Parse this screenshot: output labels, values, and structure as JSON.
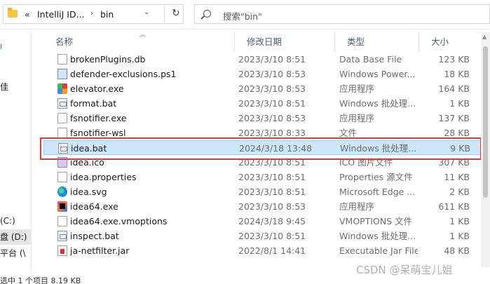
{
  "address": {
    "segments": [
      "«",
      "IntelliJ ID...",
      "›",
      "bin"
    ],
    "dropdown": "⌄",
    "refresh": "↻"
  },
  "search": {
    "placeholder": "搜索\"bin\""
  },
  "nav": {
    "items": [
      {
        "label": "ı"
      },
      {
        "label": "佳"
      },
      {
        "label": "(C:)"
      },
      {
        "label": "盘 (D:)"
      },
      {
        "label": "平台 (\\"
      }
    ]
  },
  "columns": {
    "name": "名称",
    "date": "修改日期",
    "type": "类型",
    "size": "大小"
  },
  "files": [
    {
      "name": "brokenPlugins.db",
      "date": "2023/3/10 8:51",
      "type": "Data Base File",
      "size": "123 KB",
      "icon": "file"
    },
    {
      "name": "defender-exclusions.ps1",
      "date": "2023/3/10 8:53",
      "type": "Windows Power...",
      "size": "18 KB",
      "icon": "powershell"
    },
    {
      "name": "elevator.exe",
      "date": "2023/3/10 8:53",
      "type": "应用程序",
      "size": "164 KB",
      "icon": "exe"
    },
    {
      "name": "format.bat",
      "date": "2023/3/10 8:51",
      "type": "Windows 批处理...",
      "size": "1 KB",
      "icon": "script"
    },
    {
      "name": "fsnotifier.exe",
      "date": "2023/3/10 8:53",
      "type": "应用程序",
      "size": "137 KB",
      "icon": "file"
    },
    {
      "name": "fsnotifier-wsl",
      "date": "2023/3/10 8:33",
      "type": "文件",
      "size": "28 KB",
      "icon": "file"
    },
    {
      "name": "idea.bat",
      "date": "2024/3/18 13:48",
      "type": "Windows 批处理...",
      "size": "9 KB",
      "icon": "script"
    },
    {
      "name": "idea.ico",
      "date": "2023/3/10 8:51",
      "type": "ICO 图片文件",
      "size": "307 KB",
      "icon": "ico"
    },
    {
      "name": "idea.properties",
      "date": "2023/3/10 8:51",
      "type": "Properties 源文件",
      "size": "11 KB",
      "icon": "file"
    },
    {
      "name": "idea.svg",
      "date": "2023/3/10 8:51",
      "type": "Microsoft Edge ...",
      "size": "2 KB",
      "icon": "edge"
    },
    {
      "name": "idea64.exe",
      "date": "2023/3/10 8:53",
      "type": "应用程序",
      "size": "611 KB",
      "icon": "idea"
    },
    {
      "name": "idea64.exe.vmoptions",
      "date": "2024/3/18 9:45",
      "type": "VMOPTIONS 文件",
      "size": "1 KB",
      "icon": "file"
    },
    {
      "name": "inspect.bat",
      "date": "2023/3/10 8:51",
      "type": "Windows 批处理...",
      "size": "1 KB",
      "icon": "script"
    },
    {
      "name": "ja-netfilter.jar",
      "date": "2022/8/1 14:41",
      "type": "Executable Jar File",
      "size": "48 KB",
      "icon": "jar"
    }
  ],
  "selected_index": 6,
  "status": {
    "text": "选中 1 个项目  8.19 KB"
  },
  "watermark": "CSDN @呆萌宝儿姐"
}
